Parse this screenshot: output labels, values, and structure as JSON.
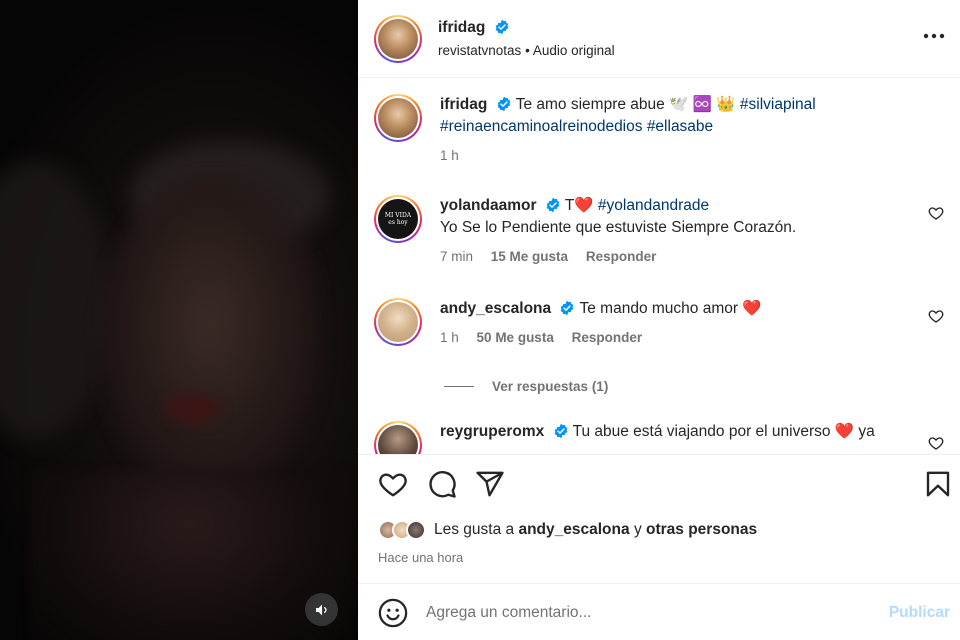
{
  "media": {
    "volume_icon": "volume-icon"
  },
  "header": {
    "username": "ifridag",
    "verified": true,
    "subtitle_user": "revistatvnotas",
    "subtitle_sep": "•",
    "subtitle_audio": "Audio original",
    "more_icon": "more-horizontal-icon"
  },
  "caption": {
    "username": "ifridag",
    "text": "Te amo siempre abue 🕊️ ♾️ 👑",
    "hashtag1": "#silviapinal",
    "hashtag2": "#reinaencaminoalreinodedios",
    "hashtag3": "#ellasabe",
    "time": "1 h"
  },
  "comments": [
    {
      "username": "yolandaamor",
      "prefix": "T❤️",
      "hashtag": "#yolandandrade",
      "text": "Yo Se lo Pendiente que estuviste Siempre Corazón.",
      "time": "7 min",
      "likes": "15 Me gusta",
      "reply": "Responder",
      "avatar_text": "MI VIDA es hoy"
    },
    {
      "username": "andy_escalona",
      "text": "Te mando mucho amor ❤️",
      "time": "1 h",
      "likes": "50 Me gusta",
      "reply": "Responder"
    },
    {
      "username": "reygruperomx",
      "text": "Tu abue está viajando por el universo ❤️  ya"
    }
  ],
  "view_replies": "Ver respuestas (1)",
  "actions": {
    "like_icon": "heart-icon",
    "comment_icon": "comment-icon",
    "share_icon": "send-icon",
    "save_icon": "bookmark-icon"
  },
  "likes": {
    "prefix": "Les gusta a",
    "user": "andy_escalona",
    "joiner": "y",
    "others": "otras personas"
  },
  "time_ago": "Hace una hora",
  "comment_box": {
    "placeholder": "Agrega un comentario...",
    "publish": "Publicar",
    "emoji_icon": "emoji-icon"
  },
  "colors": {
    "verified": "#0095f6",
    "hashtag": "#00376b",
    "publish_disabled": "#b3dbff",
    "secondary_text": "#737373",
    "heart_red": "#ed4956"
  }
}
